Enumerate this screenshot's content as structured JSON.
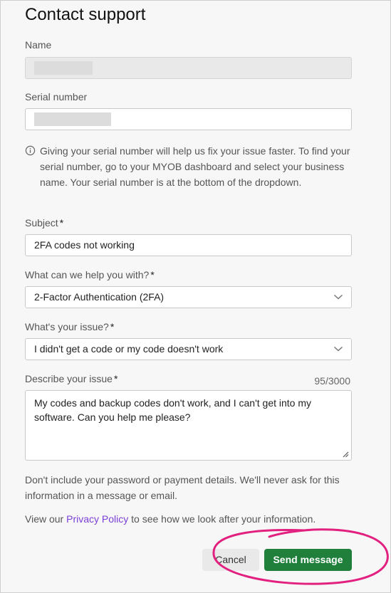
{
  "form": {
    "title": "Contact support",
    "name": {
      "label": "Name",
      "value": ""
    },
    "serial": {
      "label": "Serial number",
      "value": ""
    },
    "info_text": "Giving your serial number will help us fix your issue faster. To find your serial number, go to your MYOB dashboard and select your business name. Your serial number is at the bottom of the dropdown.",
    "subject": {
      "label": "Subject",
      "required": "*",
      "value": "2FA codes not working"
    },
    "help": {
      "label": "What can we help you with?",
      "required": "*",
      "value": "2-Factor Authentication (2FA)"
    },
    "issue": {
      "label": "What's your issue?",
      "required": "*",
      "value": "I didn't get a code or my code doesn't work"
    },
    "describe": {
      "label": "Describe your issue",
      "required": "*",
      "counter": "95/3000",
      "value": "My codes and backup codes don't work, and I can't get into my software. Can you help me please?"
    },
    "privacy_note": "Don't include your password or payment details. We'll never ask for this information in a message or email.",
    "policy": {
      "prefix": "View our ",
      "link": "Privacy Policy",
      "suffix": " to see how we look after your information."
    },
    "buttons": {
      "cancel": "Cancel",
      "send": "Send message"
    }
  },
  "colors": {
    "accent_green": "#1f7f3b",
    "link_purple": "#7a3fd6",
    "highlight_pink": "#e2207f"
  },
  "icons": [
    "info-icon",
    "chevron-down-icon",
    "resize-handle-icon"
  ]
}
